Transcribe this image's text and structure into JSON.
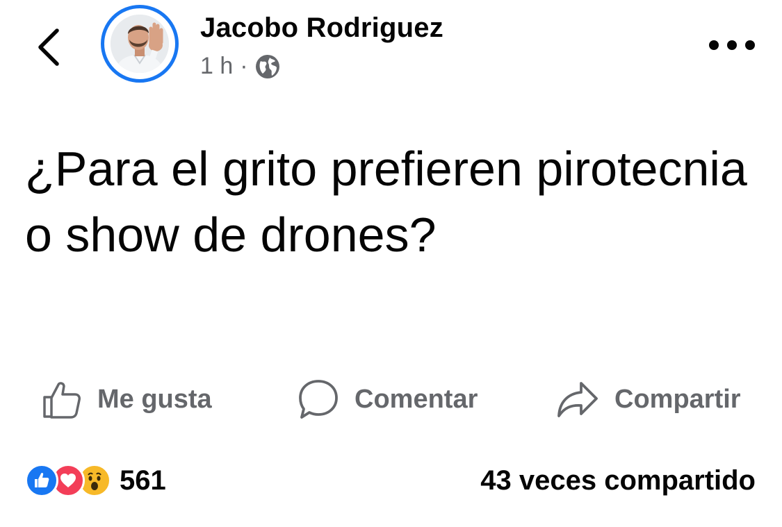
{
  "header": {
    "author": "Jacobo Rodriguez",
    "time": "1 h",
    "separator": "·",
    "back_icon": "chevron-left-icon",
    "privacy_icon": "globe-icon",
    "more_icon": "more-horizontal-icon",
    "avatar_ring_color": "#1877f2"
  },
  "post": {
    "text": "¿Para el grito prefieren pirotecnia o show de drones?"
  },
  "actions": {
    "like_label": "Me gusta",
    "comment_label": "Comentar",
    "share_label": "Compartir"
  },
  "footer": {
    "reactions": [
      "like",
      "love",
      "wow"
    ],
    "reaction_count": "561",
    "shares_text": "43 veces compartido"
  },
  "colors": {
    "secondary_text": "#65676b",
    "like_blue": "#1877f2",
    "love_red": "#f33e58",
    "wow_yellow": "#f7b928"
  }
}
